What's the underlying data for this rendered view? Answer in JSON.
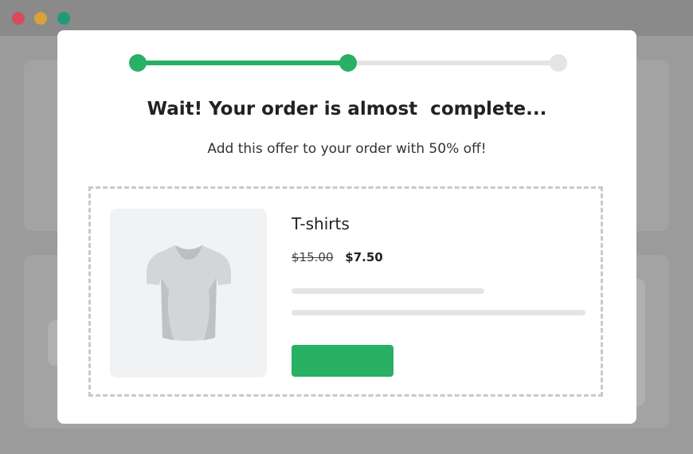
{
  "colors": {
    "window_red": "#d94a5a",
    "window_yellow": "#d8a13a",
    "window_green": "#1f9a7a",
    "accent_green": "#28b065"
  },
  "progress": {
    "steps": 3,
    "completed_step": 2
  },
  "modal": {
    "title": "Wait! Your order is almost  complete...",
    "subtitle": "Add this offer to your order with 50% off!"
  },
  "offer": {
    "product_icon": "t-shirt-icon",
    "product_name": "T-shirts",
    "original_price": "$15.00",
    "sale_price": "$7.50"
  }
}
